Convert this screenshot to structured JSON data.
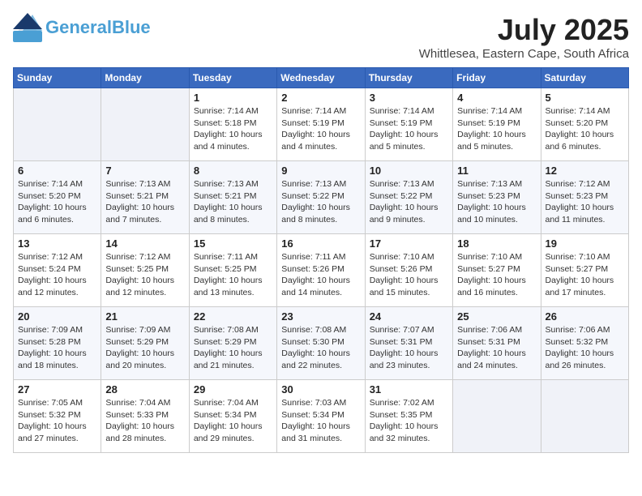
{
  "header": {
    "logo_general": "General",
    "logo_blue": "Blue",
    "month_year": "July 2025",
    "location": "Whittlesea, Eastern Cape, South Africa"
  },
  "days_of_week": [
    "Sunday",
    "Monday",
    "Tuesday",
    "Wednesday",
    "Thursday",
    "Friday",
    "Saturday"
  ],
  "weeks": [
    [
      {
        "day": "",
        "info": ""
      },
      {
        "day": "",
        "info": ""
      },
      {
        "day": "1",
        "info": "Sunrise: 7:14 AM\nSunset: 5:18 PM\nDaylight: 10 hours and 4 minutes."
      },
      {
        "day": "2",
        "info": "Sunrise: 7:14 AM\nSunset: 5:19 PM\nDaylight: 10 hours and 4 minutes."
      },
      {
        "day": "3",
        "info": "Sunrise: 7:14 AM\nSunset: 5:19 PM\nDaylight: 10 hours and 5 minutes."
      },
      {
        "day": "4",
        "info": "Sunrise: 7:14 AM\nSunset: 5:19 PM\nDaylight: 10 hours and 5 minutes."
      },
      {
        "day": "5",
        "info": "Sunrise: 7:14 AM\nSunset: 5:20 PM\nDaylight: 10 hours and 6 minutes."
      }
    ],
    [
      {
        "day": "6",
        "info": "Sunrise: 7:14 AM\nSunset: 5:20 PM\nDaylight: 10 hours and 6 minutes."
      },
      {
        "day": "7",
        "info": "Sunrise: 7:13 AM\nSunset: 5:21 PM\nDaylight: 10 hours and 7 minutes."
      },
      {
        "day": "8",
        "info": "Sunrise: 7:13 AM\nSunset: 5:21 PM\nDaylight: 10 hours and 8 minutes."
      },
      {
        "day": "9",
        "info": "Sunrise: 7:13 AM\nSunset: 5:22 PM\nDaylight: 10 hours and 8 minutes."
      },
      {
        "day": "10",
        "info": "Sunrise: 7:13 AM\nSunset: 5:22 PM\nDaylight: 10 hours and 9 minutes."
      },
      {
        "day": "11",
        "info": "Sunrise: 7:13 AM\nSunset: 5:23 PM\nDaylight: 10 hours and 10 minutes."
      },
      {
        "day": "12",
        "info": "Sunrise: 7:12 AM\nSunset: 5:23 PM\nDaylight: 10 hours and 11 minutes."
      }
    ],
    [
      {
        "day": "13",
        "info": "Sunrise: 7:12 AM\nSunset: 5:24 PM\nDaylight: 10 hours and 12 minutes."
      },
      {
        "day": "14",
        "info": "Sunrise: 7:12 AM\nSunset: 5:25 PM\nDaylight: 10 hours and 12 minutes."
      },
      {
        "day": "15",
        "info": "Sunrise: 7:11 AM\nSunset: 5:25 PM\nDaylight: 10 hours and 13 minutes."
      },
      {
        "day": "16",
        "info": "Sunrise: 7:11 AM\nSunset: 5:26 PM\nDaylight: 10 hours and 14 minutes."
      },
      {
        "day": "17",
        "info": "Sunrise: 7:10 AM\nSunset: 5:26 PM\nDaylight: 10 hours and 15 minutes."
      },
      {
        "day": "18",
        "info": "Sunrise: 7:10 AM\nSunset: 5:27 PM\nDaylight: 10 hours and 16 minutes."
      },
      {
        "day": "19",
        "info": "Sunrise: 7:10 AM\nSunset: 5:27 PM\nDaylight: 10 hours and 17 minutes."
      }
    ],
    [
      {
        "day": "20",
        "info": "Sunrise: 7:09 AM\nSunset: 5:28 PM\nDaylight: 10 hours and 18 minutes."
      },
      {
        "day": "21",
        "info": "Sunrise: 7:09 AM\nSunset: 5:29 PM\nDaylight: 10 hours and 20 minutes."
      },
      {
        "day": "22",
        "info": "Sunrise: 7:08 AM\nSunset: 5:29 PM\nDaylight: 10 hours and 21 minutes."
      },
      {
        "day": "23",
        "info": "Sunrise: 7:08 AM\nSunset: 5:30 PM\nDaylight: 10 hours and 22 minutes."
      },
      {
        "day": "24",
        "info": "Sunrise: 7:07 AM\nSunset: 5:31 PM\nDaylight: 10 hours and 23 minutes."
      },
      {
        "day": "25",
        "info": "Sunrise: 7:06 AM\nSunset: 5:31 PM\nDaylight: 10 hours and 24 minutes."
      },
      {
        "day": "26",
        "info": "Sunrise: 7:06 AM\nSunset: 5:32 PM\nDaylight: 10 hours and 26 minutes."
      }
    ],
    [
      {
        "day": "27",
        "info": "Sunrise: 7:05 AM\nSunset: 5:32 PM\nDaylight: 10 hours and 27 minutes."
      },
      {
        "day": "28",
        "info": "Sunrise: 7:04 AM\nSunset: 5:33 PM\nDaylight: 10 hours and 28 minutes."
      },
      {
        "day": "29",
        "info": "Sunrise: 7:04 AM\nSunset: 5:34 PM\nDaylight: 10 hours and 29 minutes."
      },
      {
        "day": "30",
        "info": "Sunrise: 7:03 AM\nSunset: 5:34 PM\nDaylight: 10 hours and 31 minutes."
      },
      {
        "day": "31",
        "info": "Sunrise: 7:02 AM\nSunset: 5:35 PM\nDaylight: 10 hours and 32 minutes."
      },
      {
        "day": "",
        "info": ""
      },
      {
        "day": "",
        "info": ""
      }
    ]
  ]
}
